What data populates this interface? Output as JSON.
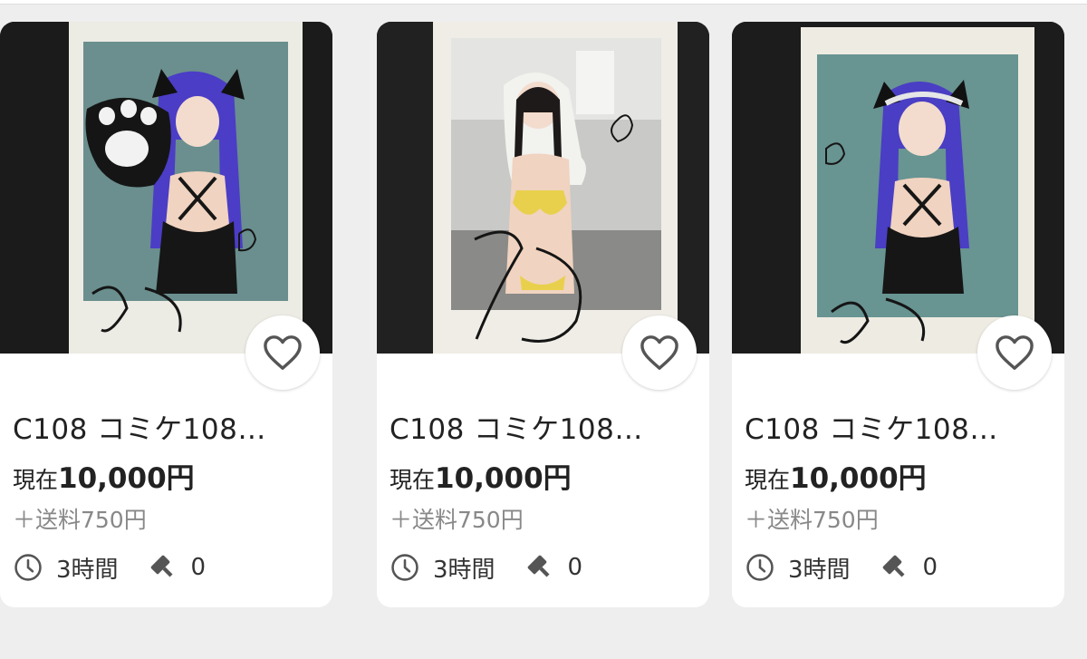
{
  "listings": [
    {
      "title": "C108 コミケ108…",
      "price_label": "現在",
      "price": "10,000円",
      "shipping": "＋送料750円",
      "time_left": "3時間",
      "bids": "0",
      "thumbnail": "autographed-instant-photo-yellow-bikini",
      "favorite_icon": "heart-outline-icon",
      "time_icon": "clock-icon",
      "bid_icon": "gavel-icon"
    },
    {
      "title": "C108 コミケ108…",
      "price_label": "現在",
      "price": "10,000円",
      "shipping": "＋送料750円",
      "time_left": "3時間",
      "bids": "0",
      "thumbnail": "autographed-instant-photo-purple-hair-maid",
      "favorite_icon": "heart-outline-icon",
      "time_icon": "clock-icon",
      "bid_icon": "gavel-icon"
    },
    {
      "title": "C108 コミケ108…",
      "price_label": "現在",
      "price": "10,000円",
      "shipping": "＋送料750円",
      "time_left": "3時間",
      "bids": "0",
      "thumbnail": "autographed-instant-photo-purple-hair-paw",
      "favorite_icon": "heart-outline-icon",
      "time_icon": "clock-icon",
      "bid_icon": "gavel-icon"
    }
  ],
  "colors": {
    "page_background": "#eeeeee",
    "card_background": "#ffffff",
    "text_primary": "#222222",
    "text_secondary": "#888888",
    "icon_gray": "#555555"
  }
}
